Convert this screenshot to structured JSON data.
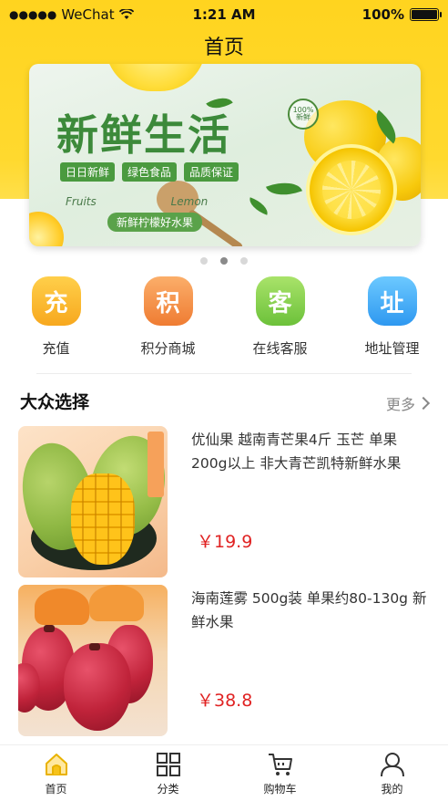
{
  "status_bar": {
    "carrier": "WeChat",
    "time": "1:21 AM",
    "battery": "100%"
  },
  "nav": {
    "title": "首页"
  },
  "banner": {
    "title": "新鲜生活",
    "tags": [
      "日日新鲜",
      "绿色食品",
      "品质保证"
    ],
    "fruits_text": "Fruits",
    "lemon_text": "Lemon",
    "subtitle": "新鲜柠檬好水果",
    "badge": "100%新鲜",
    "pager": {
      "count": 3,
      "active_index": 1
    }
  },
  "quick_menu": [
    {
      "label": "充值",
      "glyph": "充",
      "icon": "recharge-icon",
      "color_top": "#ffcf4a",
      "color_bottom": "#f7a81e"
    },
    {
      "label": "积分商城",
      "glyph": "积",
      "icon": "points-icon",
      "color_top": "#fbae6a",
      "color_bottom": "#ef7c32"
    },
    {
      "label": "在线客服",
      "glyph": "客",
      "icon": "service-icon",
      "color_top": "#a9e36a",
      "color_bottom": "#6cc13a"
    },
    {
      "label": "地址管理",
      "glyph": "址",
      "icon": "address-icon",
      "color_top": "#6cc9ff",
      "color_bottom": "#2e98f0"
    }
  ],
  "section": {
    "title": "大众选择",
    "more_label": "更多"
  },
  "products": [
    {
      "name": "优仙果 越南青芒果4斤 玉芒 单果200g以上 非大青芒凯特新鲜水果",
      "price": "￥19.9"
    },
    {
      "name": "海南莲雾 500g装 单果约80-130g 新鲜水果",
      "price": "￥38.8"
    }
  ],
  "tabbar": [
    {
      "label": "首页",
      "icon": "home-icon",
      "active": true
    },
    {
      "label": "分类",
      "icon": "grid-icon",
      "active": false
    },
    {
      "label": "购物车",
      "icon": "cart-icon",
      "active": false
    },
    {
      "label": "我的",
      "icon": "user-icon",
      "active": false
    }
  ],
  "colors": {
    "brand_yellow": "#ffd41f",
    "price_red": "#e02222",
    "tab_active": "#f6c21a"
  }
}
